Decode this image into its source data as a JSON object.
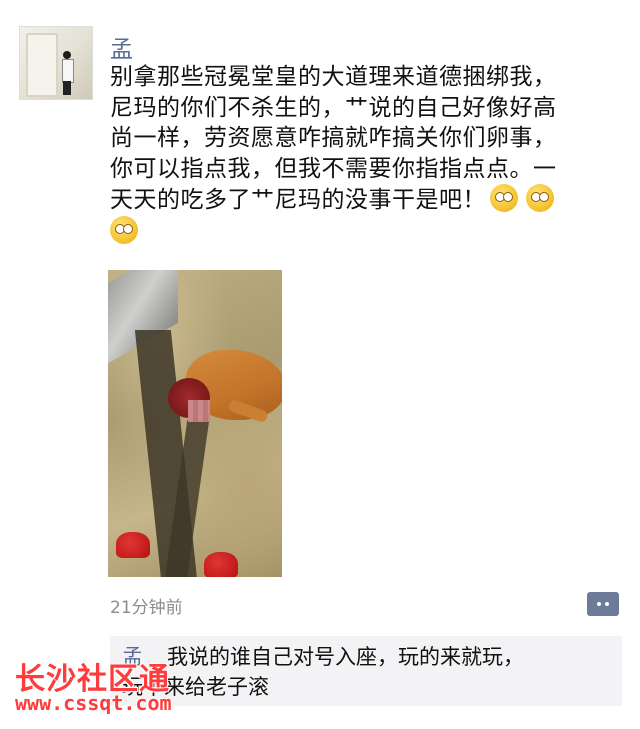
{
  "post": {
    "username": "孟",
    "lines": [
      "别拿那些冠冕堂皇的大道理来道德捆绑我，",
      "尼玛的你们不杀生的，艹说的自己好像好高",
      "尚一样，劳资愿意咋搞就咋搞关你们卵事，",
      "你可以指点我，但我不需要你指指点点。一",
      "天天的吃多了艹尼玛的没事干是吧！"
    ],
    "emojis": [
      "eye-roll-emoji",
      "eye-roll-emoji",
      "eye-roll-emoji"
    ],
    "timestamp": "21分钟前"
  },
  "comment": {
    "name": "孟",
    "text_line1": "我说的谁自己对号入座，玩的来就玩，",
    "text_line2": "玩不来给老子滚"
  },
  "watermark": {
    "title": "长沙社区通",
    "url": "www.cssqt.com"
  },
  "colors": {
    "name_blue": "#576b95",
    "timestamp_gray": "#8c8c8c",
    "comment_bg": "#f3f3f5",
    "watermark_red": "#ff3b3b"
  }
}
